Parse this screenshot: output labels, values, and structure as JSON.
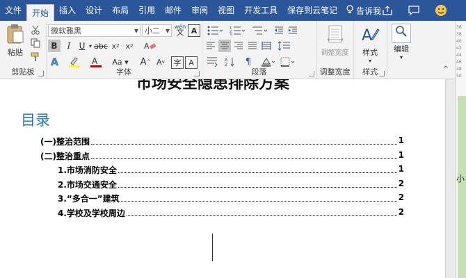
{
  "tabs": [
    {
      "label": "文件",
      "name": "tab-file"
    },
    {
      "label": "开始",
      "name": "tab-home",
      "active": true
    },
    {
      "label": "插入",
      "name": "tab-insert"
    },
    {
      "label": "设计",
      "name": "tab-design"
    },
    {
      "label": "布局",
      "name": "tab-layout"
    },
    {
      "label": "引用",
      "name": "tab-references"
    },
    {
      "label": "邮件",
      "name": "tab-mailings"
    },
    {
      "label": "审阅",
      "name": "tab-review"
    },
    {
      "label": "视图",
      "name": "tab-view"
    },
    {
      "label": "开发工具",
      "name": "tab-developer"
    },
    {
      "label": "保存到云笔记",
      "name": "tab-save-cloud"
    }
  ],
  "tell_me": "告诉我",
  "ribbon": {
    "clipboard": {
      "paste_label": "粘贴",
      "group_label": "剪贴板"
    },
    "font": {
      "font_name": "微软雅黑",
      "font_size": "小二",
      "group_label": "字体",
      "wen": "wén",
      "wen_char": "文"
    },
    "paragraph": {
      "group_label": "段落"
    },
    "width": {
      "button_label": "调整宽度",
      "group_label": "调整宽度"
    },
    "styles": {
      "button_label": "样式",
      "group_label": "样式"
    },
    "editing": {
      "button_label": "编辑"
    }
  },
  "sidepanel": {
    "ruler_values": [
      "36",
      "38",
      "40",
      "42",
      "44",
      "46",
      "48",
      "50"
    ],
    "label": "小"
  },
  "document": {
    "cut_title": "市场安全隐患排除方案",
    "heading": "目录",
    "toc": [
      {
        "text": "(一)整治范围",
        "page": "1",
        "level": 1
      },
      {
        "text": "(二)整治重点",
        "page": "1",
        "level": 1
      },
      {
        "text": "1.市场消防安全",
        "page": "1",
        "level": 2
      },
      {
        "text": "2.市场交通安全",
        "page": "2",
        "level": 2
      },
      {
        "text": "3.“多合一”建筑",
        "page": "2",
        "level": 2
      },
      {
        "text": "4.学校及学校周边",
        "page": "2",
        "level": 2
      }
    ]
  },
  "colors": {
    "accent": "#2b579a",
    "heading": "#2e74b5"
  }
}
